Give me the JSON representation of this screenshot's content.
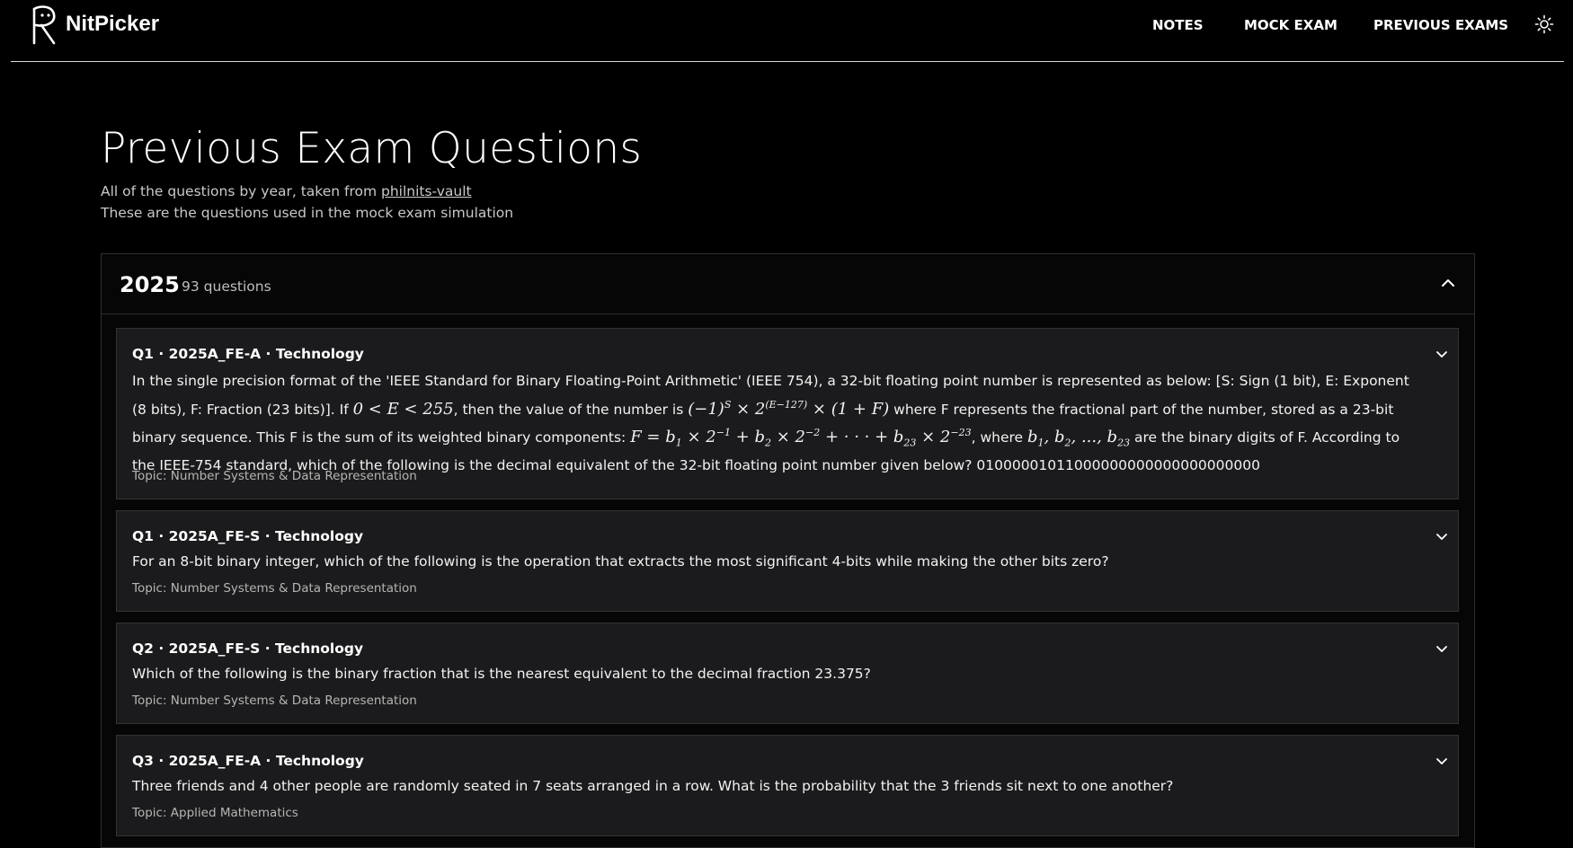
{
  "app": {
    "brand": "NitPicker"
  },
  "nav": {
    "notes": "NOTES",
    "mock_exam": "MOCK EXAM",
    "previous_exams": "PREVIOUS EXAMS"
  },
  "page": {
    "title": "Previous Exam Questions",
    "subtitle_prefix": "All of the questions by year, taken from ",
    "subtitle_link": "philnits-vault",
    "subtitle_line2": "These are the questions used in the mock exam simulation"
  },
  "year_group": {
    "year": "2025",
    "count": "93 questions",
    "expanded": true
  },
  "questions": [
    {
      "header": "Q1 · 2025A_FE-A · Technology",
      "text_a": "In the single precision format of the 'IEEE Standard for Binary Floating-Point Arithmetic' (IEEE 754), a 32-bit floating point number is represented as below: [S: Sign (1 bit), E: Exponent (8 bits), F: Fraction (23 bits)]. If ",
      "math_a": "0 < E < 255",
      "text_b": ", then the value of the number is ",
      "math_b": "(−1)^S × 2^(E−127) × (1 + F)",
      "text_c": " where F represents the fractional part of the number, stored as a 23-bit binary sequence. This F is the sum of its weighted binary components: ",
      "math_c": "F = b1 × 2^−1 + b2 × 2^−2 + · · · + b23 × 2^−23",
      "text_d": ", where ",
      "math_d": "b1, b2, ..., b23",
      "text_e": " are the binary digits of F. According to the IEEE-754 standard, which of the following is the decimal equivalent of the 32-bit floating point number given below? 01000001011000000000000000000000",
      "topic": "Topic: Number Systems & Data Representation"
    },
    {
      "header": "Q1 · 2025A_FE-S · Technology",
      "text": "For an 8-bit binary integer, which of the following is the operation that extracts the most significant 4-bits while making the other bits zero?",
      "topic": "Topic: Number Systems & Data Representation"
    },
    {
      "header": "Q2 · 2025A_FE-S · Technology",
      "text": "Which of the following is the binary fraction that is the nearest equivalent to the decimal fraction 23.375?",
      "topic": "Topic: Number Systems & Data Representation"
    },
    {
      "header": "Q3 · 2025A_FE-A · Technology",
      "text": "Three friends and 4 other people are randomly seated in 7 seats arranged in a row. What is the probability that the 3 friends sit next to one another?",
      "topic": "Topic: Applied Mathematics"
    }
  ],
  "icons": {
    "logo": "r-mascot-logo",
    "theme": "sun-icon",
    "collapse": "chevron-up-icon",
    "expand": "chevron-down-icon"
  },
  "colors": {
    "background": "#000000",
    "card": "#1b1b1d",
    "border": "#333333",
    "text": "#ffffff",
    "muted": "#b5b5b5"
  }
}
